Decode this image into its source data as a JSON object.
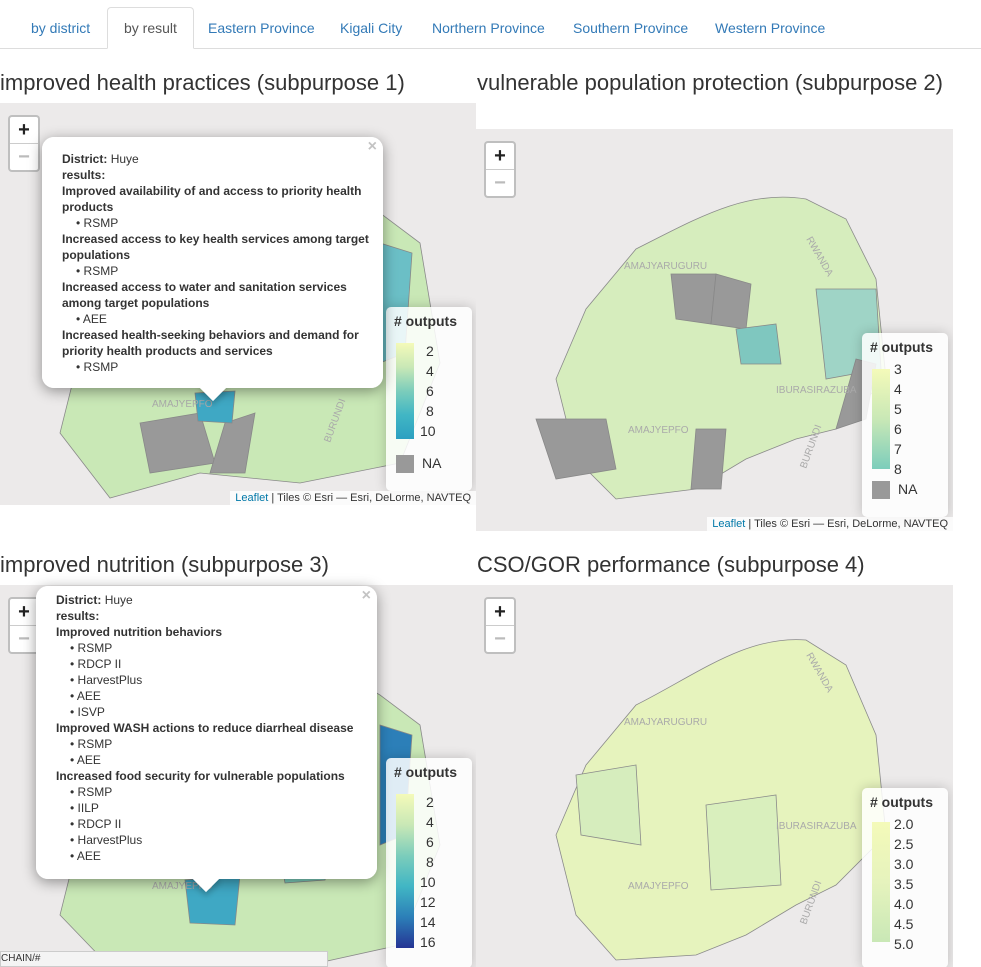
{
  "tabs": [
    {
      "label": "by district"
    },
    {
      "label": "by result"
    },
    {
      "label": "Eastern Province"
    },
    {
      "label": "Kigali City"
    },
    {
      "label": "Northern Province"
    },
    {
      "label": "Southern Province"
    },
    {
      "label": "Western Province"
    }
  ],
  "active_tab": "by result",
  "panels": [
    {
      "title": "improved health practices (subpurpose 1)",
      "legend": {
        "title": "# outputs",
        "ticks": [
          "2",
          "4",
          "6",
          "8",
          "10"
        ],
        "na": "NA"
      },
      "attribution": {
        "link": "Leaflet",
        "text": " | Tiles © Esri — Esri, DeLorme, NAVTEQ"
      },
      "popup": {
        "district_label": "District:",
        "district": "Huye",
        "results_label": "results:",
        "results": [
          {
            "name": "Improved availability of and access to priority health products",
            "items": [
              "RSMP"
            ]
          },
          {
            "name": "Increased access to key health services among target populations",
            "items": [
              "RSMP"
            ]
          },
          {
            "name": "Increased access to water and sanitation services among target populations",
            "items": [
              "AEE"
            ]
          },
          {
            "name": "Increased health-seeking behaviors and demand for priority health products and services",
            "items": [
              "RSMP"
            ]
          }
        ]
      }
    },
    {
      "title": "vulnerable population protection (subpurpose 2)",
      "legend": {
        "title": "# outputs",
        "ticks": [
          "3",
          "4",
          "5",
          "6",
          "7",
          "8"
        ],
        "na": "NA"
      },
      "attribution": {
        "link": "Leaflet",
        "text": " | Tiles © Esri — Esri, DeLorme, NAVTEQ"
      }
    },
    {
      "title": "improved nutrition (subpurpose 3)",
      "legend": {
        "title": "# outputs",
        "ticks": [
          "2",
          "4",
          "6",
          "8",
          "10",
          "12",
          "14",
          "16"
        ]
      },
      "popup": {
        "district_label": "District:",
        "district": "Huye",
        "results_label": "results:",
        "results": [
          {
            "name": "Improved nutrition behaviors",
            "items": [
              "RSMP",
              "RDCP II",
              "HarvestPlus",
              "AEE",
              "ISVP"
            ]
          },
          {
            "name": "Improved WASH actions to reduce diarrheal disease",
            "items": [
              "RSMP",
              "AEE"
            ]
          },
          {
            "name": "Increased food security for vulnerable populations",
            "items": [
              "RSMP",
              "IILP",
              "RDCP II",
              "HarvestPlus",
              "AEE"
            ]
          }
        ]
      }
    },
    {
      "title": "CSO/GOR performance (subpurpose 4)",
      "legend": {
        "title": "# outputs",
        "ticks": [
          "2.0",
          "2.5",
          "3.0",
          "3.5",
          "4.0",
          "4.5",
          "5.0"
        ]
      }
    }
  ],
  "map_labels": {
    "rwanda": "RWANDA",
    "burundi": "BURUNDI",
    "amajyaruguru": "AMAJYARUGURU",
    "amajyepfo": "AMAJYEPFO",
    "iburasirazuba": "IBURASIRAZUBA"
  },
  "colors": {
    "tab_link": "#337ab7",
    "map_bg": "#eceaea",
    "na_gray": "#999999",
    "scale_low": "#f7fcb9",
    "scale_high": "#2c7fb8"
  },
  "status_bar": "CHAIN/#"
}
